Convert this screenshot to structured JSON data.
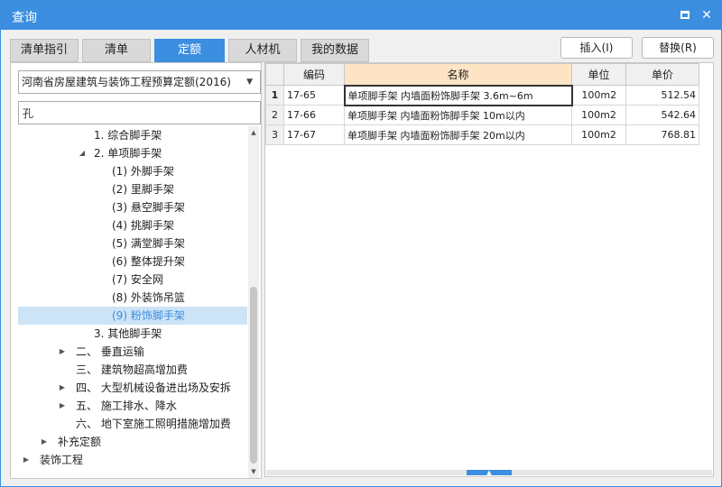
{
  "window": {
    "title": "查询"
  },
  "tabs": [
    {
      "label": "清单指引"
    },
    {
      "label": "清单"
    },
    {
      "label": "定额"
    },
    {
      "label": "人材机"
    },
    {
      "label": "我的数据"
    }
  ],
  "actions": {
    "insert": "插入(I)",
    "replace": "替换(R)"
  },
  "library": {
    "selected": "河南省房屋建筑与装饰工程预算定额(2016)"
  },
  "search": {
    "value": "孔"
  },
  "tree": [
    {
      "label": "1. 综合脚手架"
    },
    {
      "label": "2. 单项脚手架"
    },
    {
      "label": "(1) 外脚手架"
    },
    {
      "label": "(2) 里脚手架"
    },
    {
      "label": "(3) 悬空脚手架"
    },
    {
      "label": "(4) 挑脚手架"
    },
    {
      "label": "(5) 满堂脚手架"
    },
    {
      "label": "(6) 整体提升架"
    },
    {
      "label": "(7) 安全网"
    },
    {
      "label": "(8) 外装饰吊篮"
    },
    {
      "label": "(9) 粉饰脚手架"
    },
    {
      "label": "3. 其他脚手架"
    },
    {
      "label": "二、 垂直运输"
    },
    {
      "label": "三、 建筑物超高增加费"
    },
    {
      "label": "四、 大型机械设备进出场及安拆"
    },
    {
      "label": "五、 施工排水、降水"
    },
    {
      "label": "六、 地下室施工照明措施增加费"
    },
    {
      "label": "补充定额"
    },
    {
      "label": "装饰工程"
    }
  ],
  "grid": {
    "headers": {
      "code": "编码",
      "name": "名称",
      "unit": "单位",
      "price": "单价"
    },
    "rows": [
      {
        "n": "1",
        "code": "17-65",
        "name": "单项脚手架 内墙面粉饰脚手架 3.6m~6m",
        "unit": "100m2",
        "price": "512.54"
      },
      {
        "n": "2",
        "code": "17-66",
        "name": "单项脚手架 内墙面粉饰脚手架 10m以内",
        "unit": "100m2",
        "price": "542.64"
      },
      {
        "n": "3",
        "code": "17-67",
        "name": "单项脚手架 内墙面粉饰脚手架 20m以内",
        "unit": "100m2",
        "price": "768.81"
      }
    ]
  },
  "colors": {
    "accent": "#3b8ee0",
    "selection": "#cde4f7",
    "name_header": "#fde4c4"
  },
  "icons": {
    "maximize": "maximize-icon",
    "close": "close-icon",
    "dropdown": "chevron-down-icon"
  }
}
